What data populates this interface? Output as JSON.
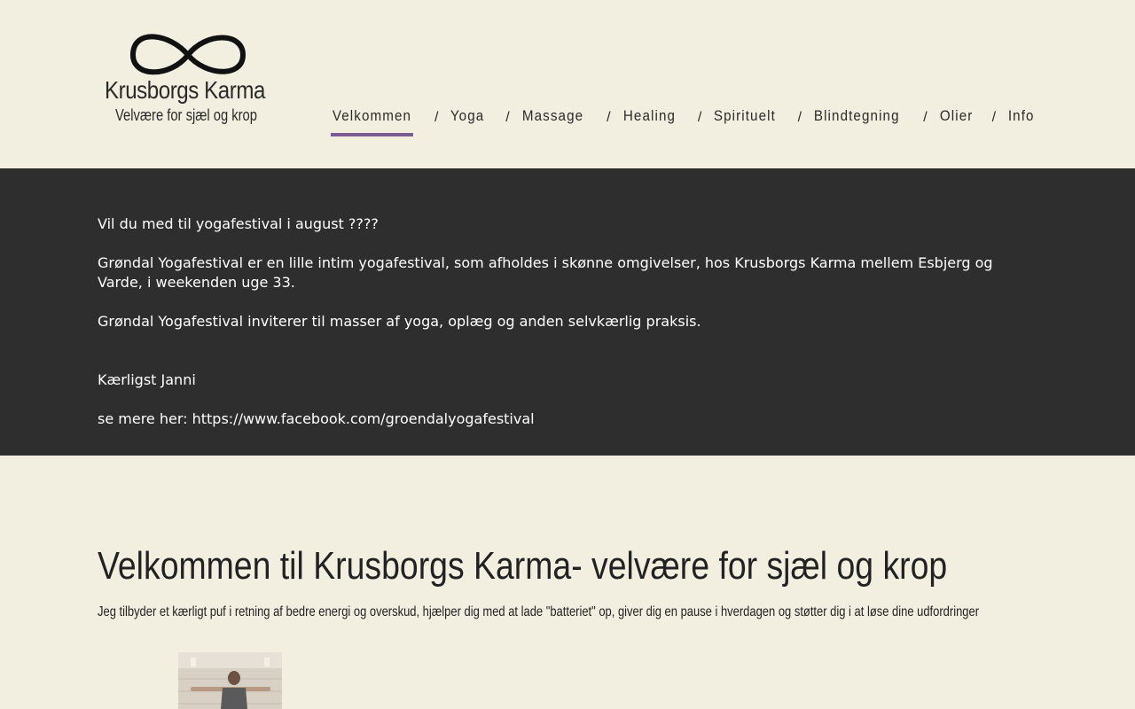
{
  "logo": {
    "title": "Krusborgs Karma",
    "subtitle": "Velvære for sjæl og krop"
  },
  "nav": {
    "items": [
      {
        "label": "Velkommen",
        "active": true
      },
      {
        "label": "Yoga",
        "active": false
      },
      {
        "label": "Massage",
        "active": false
      },
      {
        "label": "Healing",
        "active": false
      },
      {
        "label": "Spirituelt",
        "active": false
      },
      {
        "label": "Blindtegning",
        "active": false
      },
      {
        "label": "Olier",
        "active": false
      },
      {
        "label": "Info",
        "active": false
      }
    ],
    "separator": "/",
    "active_color": "#7b5c93"
  },
  "banner": {
    "line1": "Vil du med til yogafestival i august ????",
    "line2": "Grøndal Yogafestival er en lille intim yogafestival, som afholdes i skønne omgivelser, hos Krusborgs Karma mellem Esbjerg og Varde, i weekenden uge 33.",
    "line3": "Grøndal Yogafestival inviterer til masser af yoga, oplæg og anden selvkærlig praksis.",
    "signature": "Kærligst Janni",
    "link_prefix": "se mere her: ",
    "link": "https://www.facebook.com/groendalyogafestival",
    "background": "#2e2e2e"
  },
  "main": {
    "title": "Velkommen til Krusborgs Karma- velvære for sjæl og krop",
    "intro": "Jeg tilbyder et kærligt puf i retning af bedre energi og overskud, hjælper dig med at lade \"batteriet\" op, giver dig en pause i hverdagen og støtter dig i at løse dine udfordringer"
  },
  "colors": {
    "page_background": "#f2eee0",
    "text": "#222222"
  }
}
